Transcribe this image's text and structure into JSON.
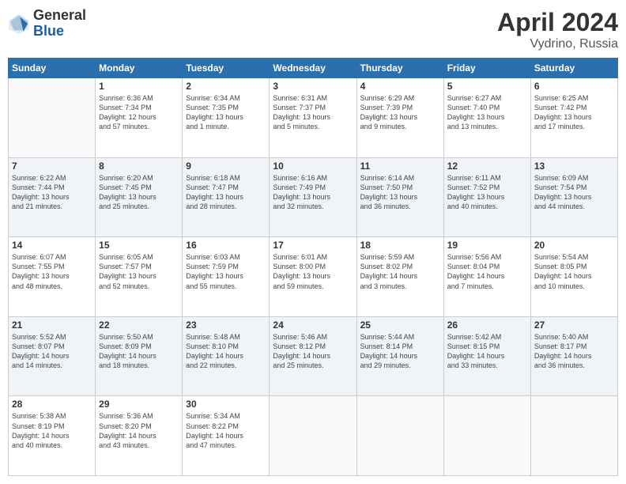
{
  "header": {
    "logo_general": "General",
    "logo_blue": "Blue",
    "month": "April 2024",
    "location": "Vydrino, Russia"
  },
  "days_of_week": [
    "Sunday",
    "Monday",
    "Tuesday",
    "Wednesday",
    "Thursday",
    "Friday",
    "Saturday"
  ],
  "weeks": [
    [
      {
        "day": "",
        "info": ""
      },
      {
        "day": "1",
        "info": "Sunrise: 6:36 AM\nSunset: 7:34 PM\nDaylight: 12 hours\nand 57 minutes."
      },
      {
        "day": "2",
        "info": "Sunrise: 6:34 AM\nSunset: 7:35 PM\nDaylight: 13 hours\nand 1 minute."
      },
      {
        "day": "3",
        "info": "Sunrise: 6:31 AM\nSunset: 7:37 PM\nDaylight: 13 hours\nand 5 minutes."
      },
      {
        "day": "4",
        "info": "Sunrise: 6:29 AM\nSunset: 7:39 PM\nDaylight: 13 hours\nand 9 minutes."
      },
      {
        "day": "5",
        "info": "Sunrise: 6:27 AM\nSunset: 7:40 PM\nDaylight: 13 hours\nand 13 minutes."
      },
      {
        "day": "6",
        "info": "Sunrise: 6:25 AM\nSunset: 7:42 PM\nDaylight: 13 hours\nand 17 minutes."
      }
    ],
    [
      {
        "day": "7",
        "info": "Sunrise: 6:22 AM\nSunset: 7:44 PM\nDaylight: 13 hours\nand 21 minutes."
      },
      {
        "day": "8",
        "info": "Sunrise: 6:20 AM\nSunset: 7:45 PM\nDaylight: 13 hours\nand 25 minutes."
      },
      {
        "day": "9",
        "info": "Sunrise: 6:18 AM\nSunset: 7:47 PM\nDaylight: 13 hours\nand 28 minutes."
      },
      {
        "day": "10",
        "info": "Sunrise: 6:16 AM\nSunset: 7:49 PM\nDaylight: 13 hours\nand 32 minutes."
      },
      {
        "day": "11",
        "info": "Sunrise: 6:14 AM\nSunset: 7:50 PM\nDaylight: 13 hours\nand 36 minutes."
      },
      {
        "day": "12",
        "info": "Sunrise: 6:11 AM\nSunset: 7:52 PM\nDaylight: 13 hours\nand 40 minutes."
      },
      {
        "day": "13",
        "info": "Sunrise: 6:09 AM\nSunset: 7:54 PM\nDaylight: 13 hours\nand 44 minutes."
      }
    ],
    [
      {
        "day": "14",
        "info": "Sunrise: 6:07 AM\nSunset: 7:55 PM\nDaylight: 13 hours\nand 48 minutes."
      },
      {
        "day": "15",
        "info": "Sunrise: 6:05 AM\nSunset: 7:57 PM\nDaylight: 13 hours\nand 52 minutes."
      },
      {
        "day": "16",
        "info": "Sunrise: 6:03 AM\nSunset: 7:59 PM\nDaylight: 13 hours\nand 55 minutes."
      },
      {
        "day": "17",
        "info": "Sunrise: 6:01 AM\nSunset: 8:00 PM\nDaylight: 13 hours\nand 59 minutes."
      },
      {
        "day": "18",
        "info": "Sunrise: 5:59 AM\nSunset: 8:02 PM\nDaylight: 14 hours\nand 3 minutes."
      },
      {
        "day": "19",
        "info": "Sunrise: 5:56 AM\nSunset: 8:04 PM\nDaylight: 14 hours\nand 7 minutes."
      },
      {
        "day": "20",
        "info": "Sunrise: 5:54 AM\nSunset: 8:05 PM\nDaylight: 14 hours\nand 10 minutes."
      }
    ],
    [
      {
        "day": "21",
        "info": "Sunrise: 5:52 AM\nSunset: 8:07 PM\nDaylight: 14 hours\nand 14 minutes."
      },
      {
        "day": "22",
        "info": "Sunrise: 5:50 AM\nSunset: 8:09 PM\nDaylight: 14 hours\nand 18 minutes."
      },
      {
        "day": "23",
        "info": "Sunrise: 5:48 AM\nSunset: 8:10 PM\nDaylight: 14 hours\nand 22 minutes."
      },
      {
        "day": "24",
        "info": "Sunrise: 5:46 AM\nSunset: 8:12 PM\nDaylight: 14 hours\nand 25 minutes."
      },
      {
        "day": "25",
        "info": "Sunrise: 5:44 AM\nSunset: 8:14 PM\nDaylight: 14 hours\nand 29 minutes."
      },
      {
        "day": "26",
        "info": "Sunrise: 5:42 AM\nSunset: 8:15 PM\nDaylight: 14 hours\nand 33 minutes."
      },
      {
        "day": "27",
        "info": "Sunrise: 5:40 AM\nSunset: 8:17 PM\nDaylight: 14 hours\nand 36 minutes."
      }
    ],
    [
      {
        "day": "28",
        "info": "Sunrise: 5:38 AM\nSunset: 8:19 PM\nDaylight: 14 hours\nand 40 minutes."
      },
      {
        "day": "29",
        "info": "Sunrise: 5:36 AM\nSunset: 8:20 PM\nDaylight: 14 hours\nand 43 minutes."
      },
      {
        "day": "30",
        "info": "Sunrise: 5:34 AM\nSunset: 8:22 PM\nDaylight: 14 hours\nand 47 minutes."
      },
      {
        "day": "",
        "info": ""
      },
      {
        "day": "",
        "info": ""
      },
      {
        "day": "",
        "info": ""
      },
      {
        "day": "",
        "info": ""
      }
    ]
  ]
}
